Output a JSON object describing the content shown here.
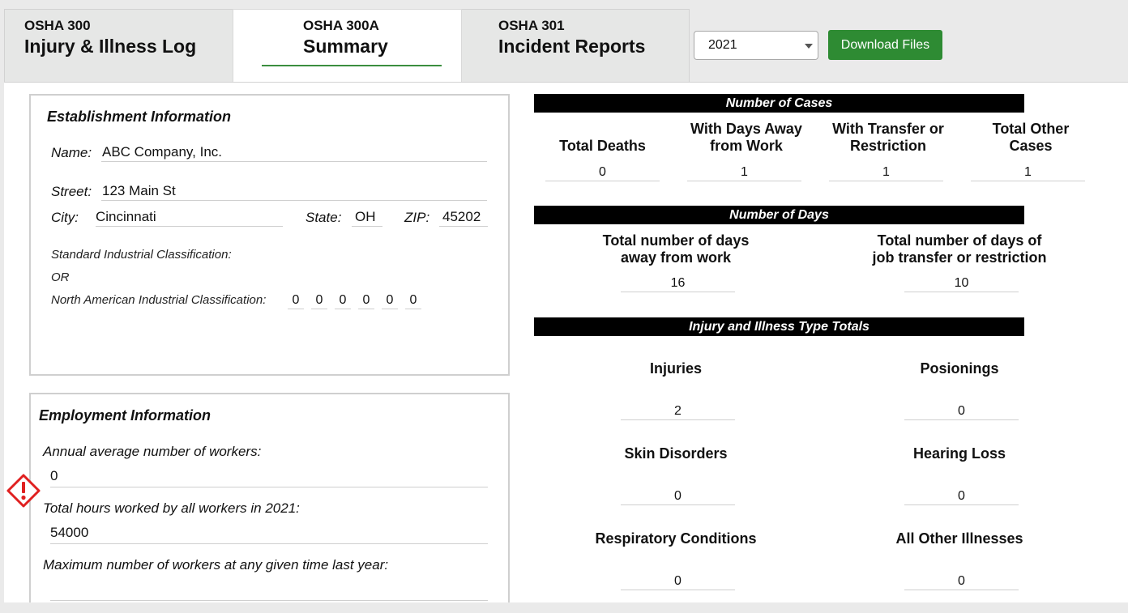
{
  "tabs": [
    {
      "code": "OSHA 300",
      "title": "Injury & Illness Log"
    },
    {
      "code": "OSHA 300A",
      "title": "Summary"
    },
    {
      "code": "OSHA 301",
      "title": "Incident Reports"
    }
  ],
  "toolbar": {
    "year": "2021",
    "download_label": "Download Files"
  },
  "establishment": {
    "title": "Establishment Information",
    "name_label": "Name:",
    "name": "ABC Company, Inc.",
    "street_label": "Street:",
    "street": "123 Main St",
    "city_label": "City:",
    "city": "Cincinnati",
    "state_label": "State:",
    "state": "OH",
    "zip_label": "ZIP:",
    "zip": "45202",
    "sic_label": "Standard Industrial Classification:",
    "or_label": "OR",
    "naics_label": "North American Industrial Classification:",
    "naics_digits": [
      "0",
      "0",
      "0",
      "0",
      "0",
      "0"
    ]
  },
  "employment": {
    "title": "Employment Information",
    "avg_workers_label": "Annual average number of workers:",
    "avg_workers": "0",
    "total_hours_label": "Total hours worked by all workers in 2021:",
    "total_hours": "54000",
    "max_workers_label": "Maximum number of workers at any given time last year:",
    "max_workers": ""
  },
  "cases": {
    "header": "Number of Cases",
    "deaths_label": "Total Deaths",
    "deaths": "0",
    "days_away_label_1": "With Days Away",
    "days_away_label_2": "from Work",
    "days_away": "1",
    "transfer_label_1": "With Transfer or",
    "transfer_label_2": "Restriction",
    "transfer": "1",
    "other_label_1": "Total Other",
    "other_label_2": "Cases",
    "other": "1"
  },
  "days": {
    "header": "Number of Days",
    "away_label_1": "Total number of days",
    "away_label_2": "away from work",
    "away": "16",
    "transfer_label_1": "Total number of days of",
    "transfer_label_2": "job transfer or restriction",
    "transfer": "10"
  },
  "types": {
    "header": "Injury and Illness Type Totals",
    "injuries_label": "Injuries",
    "injuries": "2",
    "poisonings_label": "Posionings",
    "poisonings": "0",
    "skin_label": "Skin Disorders",
    "skin": "0",
    "hearing_label": "Hearing Loss",
    "hearing": "0",
    "respiratory_label": "Respiratory Conditions",
    "respiratory": "0",
    "other_label": "All Other Illnesses",
    "other": "0"
  },
  "colors": {
    "accent_green": "#2e8b33",
    "alert_red": "#e02020"
  },
  "icons": {
    "alert": "warning-diamond-icon",
    "select": "chevron-down-icon"
  }
}
